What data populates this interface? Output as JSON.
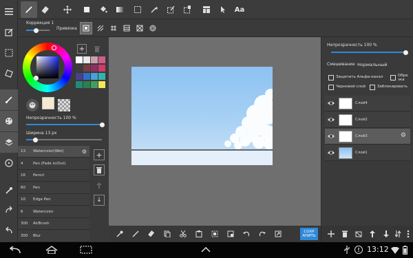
{
  "topbar": {
    "text_tool_label": "Aa"
  },
  "subbar": {
    "correction_label": "Коррекция 1",
    "snap_label": "Привязка"
  },
  "colors": {
    "accent": "#2f89d9",
    "primary": "#f4ead0",
    "swatches": [
      "#ffffff",
      "#e8e8e8",
      "#c9a0a8",
      "#d05d8a",
      "#3d3d3d",
      "#7a3d3d",
      "#8e2e64",
      "#d23a6a",
      "#4a3f8e",
      "#2f6fc7",
      "#49a0d6",
      "#2fb4b0",
      "#1f8c7a",
      "#2f7d52",
      "#3fa05e",
      "#f1e85a"
    ]
  },
  "left": {
    "opacity_label": "Непрозрачность 100 %",
    "opacity_value": 1.0,
    "width_label": "Ширина 13 px",
    "width_value": 0.12,
    "add_color_symbol": "+"
  },
  "brushes": [
    {
      "size": "13",
      "name": "Watercolor(Wet)",
      "selected": true
    },
    {
      "size": "4",
      "name": "Pen (Fade in/Out)",
      "selected": false
    },
    {
      "size": "16",
      "name": "Pencil",
      "selected": false
    },
    {
      "size": "60",
      "name": "Pen",
      "selected": false
    },
    {
      "size": "10",
      "name": "Edge Pen",
      "selected": false
    },
    {
      "size": "6",
      "name": "Watercolor",
      "selected": false
    },
    {
      "size": "300",
      "name": "AirBrush",
      "selected": false
    },
    {
      "size": "300",
      "name": "Blur",
      "selected": false
    }
  ],
  "brush_side": {
    "add_symbol": "+",
    "down_symbol": "↓"
  },
  "right": {
    "opacity_label": "Непрозрачность 100 %",
    "opacity_value": 1.0,
    "blend_label": "Смешивание",
    "blend_value": "Нормальный",
    "protect_alpha": "Защитить Альфа-канал",
    "clip": "Обре зка",
    "draft": "Черновой слой",
    "lock": "Заблокировать",
    "layers": [
      {
        "name": "Слой4",
        "selected": false,
        "thumb": "white"
      },
      {
        "name": "Слой2",
        "selected": false,
        "thumb": "white"
      },
      {
        "name": "Слой3",
        "selected": true,
        "thumb": "white"
      },
      {
        "name": "Слой1",
        "selected": false,
        "thumb": "sky"
      }
    ]
  },
  "bottombar": {
    "save_label": "СОХР АНИТЬ"
  },
  "navbar": {
    "time": "13:12"
  }
}
